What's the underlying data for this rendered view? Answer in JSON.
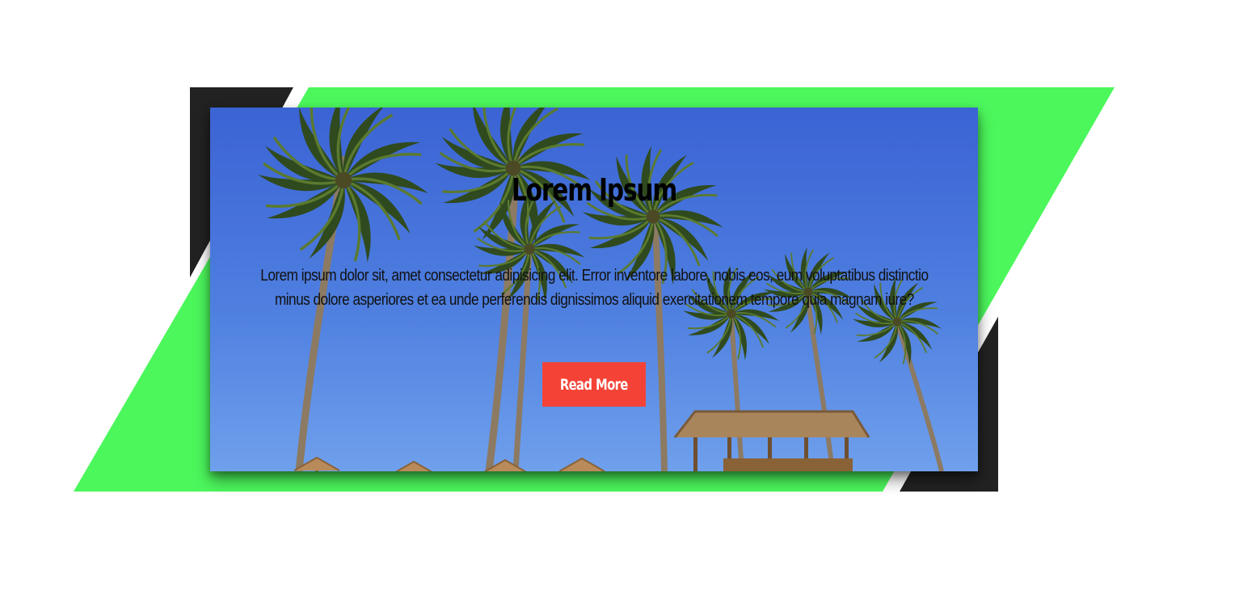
{
  "card": {
    "title": "Lorem Ipsum",
    "text": "Lorem ipsum dolor sit, amet consectetur adipisicing elit. Error inventore labore, nobis eos, eum voluptatibus distinctio minus dolore asperiores et ea unde perferendis dignissimos aliquid exercitationem tempore quia magnam iure?",
    "button_label": "Read More",
    "image_name": "palm-beach-image"
  },
  "colors": {
    "accent_green": "#4cf75c",
    "dark_frame": "#222222",
    "button_red": "#f44336",
    "sky_top": "#3b63d4",
    "sky_bottom": "#6fa0ec"
  }
}
